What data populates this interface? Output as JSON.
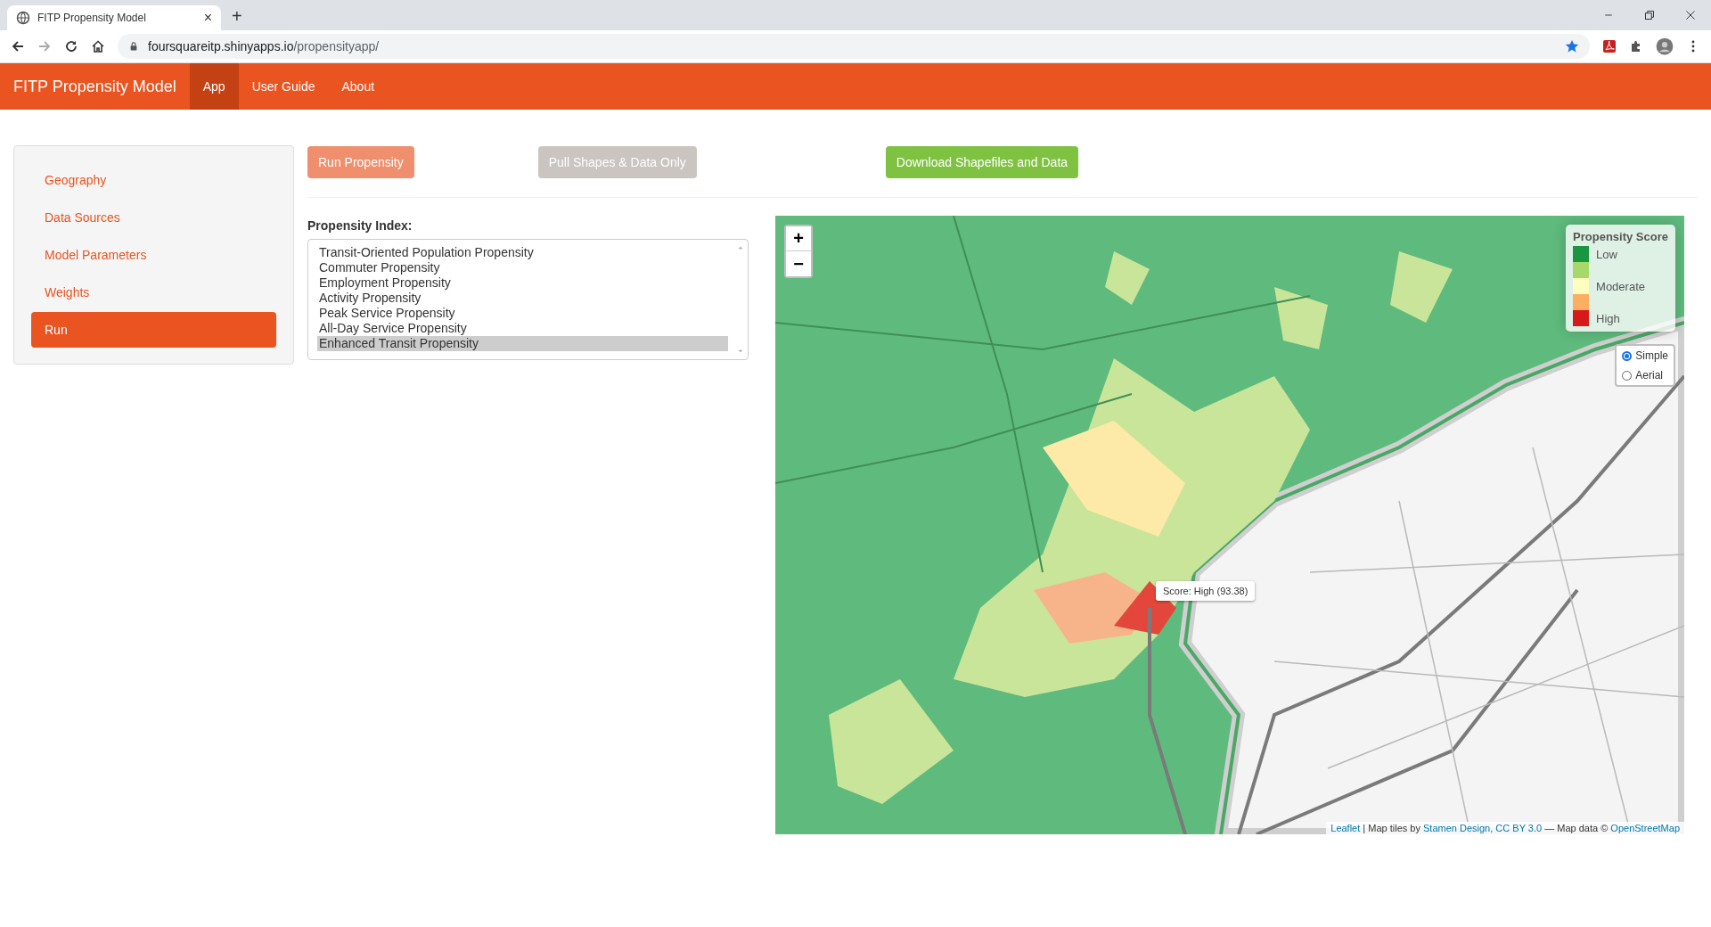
{
  "browser": {
    "tab": {
      "title": "FITP Propensity Model",
      "close": "×"
    },
    "new_tab": "+",
    "url": {
      "host": "foursquareitp.shinyapps.io",
      "path": "/propensityapp/"
    }
  },
  "navbar": {
    "brand": "FITP Propensity Model",
    "items": [
      {
        "label": "App",
        "selected": true
      },
      {
        "label": "User Guide",
        "selected": false
      },
      {
        "label": "About",
        "selected": false
      }
    ]
  },
  "sidebar": {
    "items": [
      {
        "label": "Geography",
        "selected": false
      },
      {
        "label": "Data Sources",
        "selected": false
      },
      {
        "label": "Model Parameters",
        "selected": false
      },
      {
        "label": "Weights",
        "selected": false
      },
      {
        "label": "Run",
        "selected": true
      }
    ]
  },
  "actions": [
    {
      "label": "Run Propensity",
      "kind": "primary",
      "disabled": true
    },
    {
      "label": "Pull Shapes & Data Only",
      "kind": "default",
      "disabled": true
    },
    {
      "label": "Download Shapefiles and Data",
      "kind": "success",
      "disabled": false
    }
  ],
  "index": {
    "label": "Propensity Index:",
    "options": [
      {
        "label": "Transit-Oriented Population Propensity",
        "selected": false
      },
      {
        "label": "Commuter Propensity",
        "selected": false
      },
      {
        "label": "Employment Propensity",
        "selected": false
      },
      {
        "label": "Activity Propensity",
        "selected": false
      },
      {
        "label": "Peak Service Propensity",
        "selected": false
      },
      {
        "label": "All-Day Service Propensity",
        "selected": false
      },
      {
        "label": "Enhanced Transit Propensity",
        "selected": true
      }
    ]
  },
  "map": {
    "zoom_in": "+",
    "zoom_out": "−",
    "legend": {
      "title": "Propensity Score",
      "items": [
        {
          "color": "#1a9641",
          "label": "Low"
        },
        {
          "color": "#a6d96a"
        },
        {
          "color": "#ffffbf",
          "label": "Moderate"
        },
        {
          "color": "#fdae61"
        },
        {
          "color": "#d7191c",
          "label": "High"
        }
      ]
    },
    "basemap": [
      {
        "label": "Simple",
        "selected": true
      },
      {
        "label": "Aerial",
        "selected": false
      }
    ],
    "tooltip": "Score: High (93.38)",
    "attribution": [
      {
        "text": "Leaflet",
        "kind": "link"
      },
      {
        "text": "| Map tiles by",
        "kind": "text"
      },
      {
        "text": "Stamen Design, CC BY 3.0",
        "kind": "link"
      },
      {
        "text": "— Map data ©",
        "kind": "text"
      },
      {
        "text": "OpenStreetMap",
        "kind": "link"
      }
    ]
  }
}
